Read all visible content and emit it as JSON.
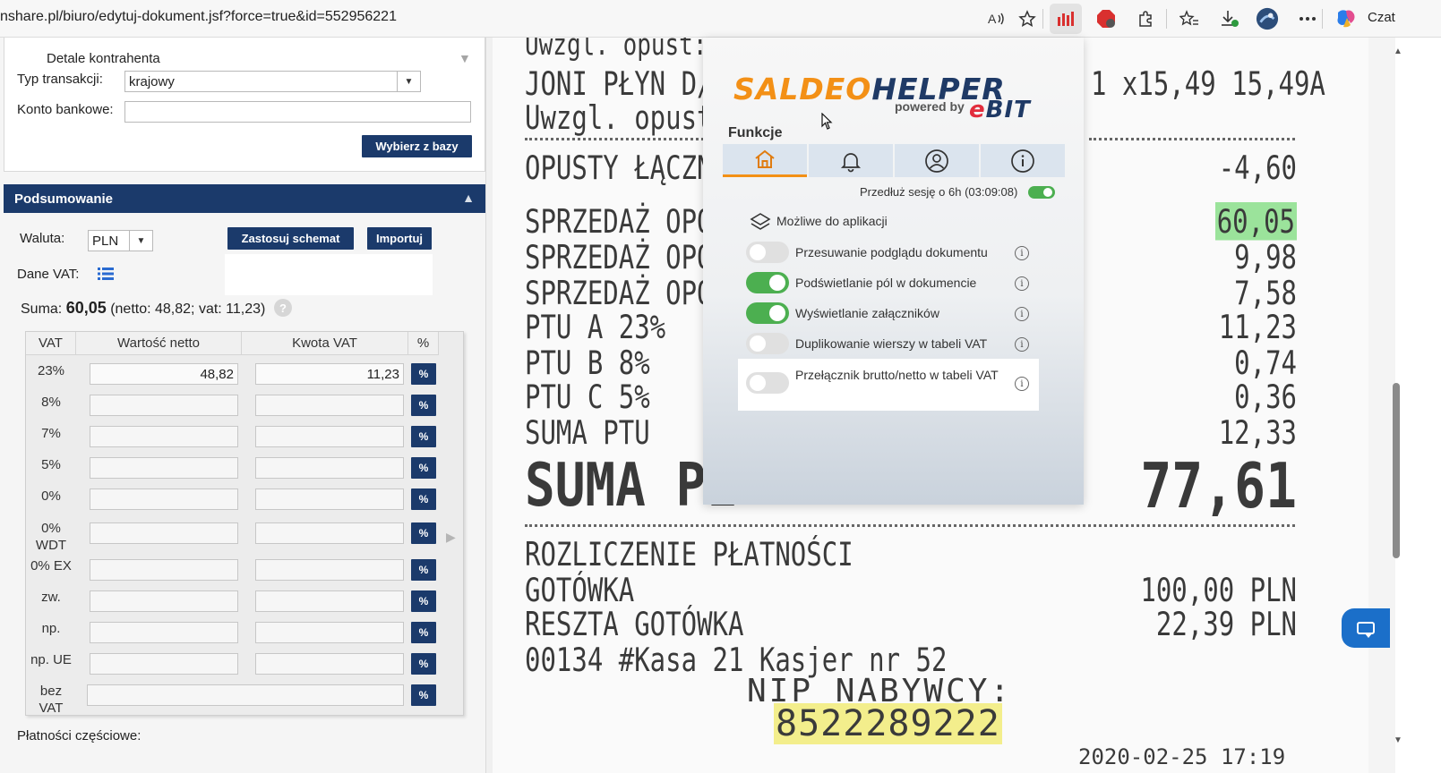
{
  "browser": {
    "url": "nshare.pl/biuro/edytuj-dokument.jsf?force=true&id=552956221",
    "icons": [
      "read-aloud-icon",
      "favorite-star-icon",
      "extension-active-icon",
      "adblock-icon",
      "extensions-puzzle-icon",
      "favorites-icon",
      "downloads-icon",
      "profile-icon",
      "more-icon",
      "copilot-icon"
    ],
    "chat_label": "Czat"
  },
  "contractor": {
    "details_label": "Detale kontrahenta",
    "transaction_type_label": "Typ transakcji:",
    "transaction_type_value": "krajowy",
    "bank_account_label": "Konto bankowe:",
    "bank_account_value": "",
    "select_from_db_button": "Wybierz z bazy"
  },
  "summary": {
    "header": "Podsumowanie",
    "currency_label": "Waluta:",
    "currency_value": "PLN",
    "apply_scheme_button": "Zastosuj schemat",
    "import_button": "Importuj",
    "vat_data_label": "Dane VAT:",
    "suma_label": "Suma:",
    "suma_value": "60,05",
    "suma_details": "(netto: 48,82; vat: 11,23)",
    "help_icon": "?"
  },
  "vat_table": {
    "headers": [
      "VAT",
      "Wartość netto",
      "Kwota VAT",
      "%"
    ],
    "rows": [
      {
        "rate": "23%",
        "netto": "48,82",
        "vat": "11,23"
      },
      {
        "rate": "8%",
        "netto": "",
        "vat": ""
      },
      {
        "rate": "7%",
        "netto": "",
        "vat": ""
      },
      {
        "rate": "5%",
        "netto": "",
        "vat": ""
      },
      {
        "rate": "0%",
        "netto": "",
        "vat": ""
      },
      {
        "rate": "0% WDT",
        "netto": "",
        "vat": ""
      },
      {
        "rate": "0% EX",
        "netto": "",
        "vat": ""
      },
      {
        "rate": "zw.",
        "netto": "",
        "vat": ""
      },
      {
        "rate": "np.",
        "netto": "",
        "vat": ""
      },
      {
        "rate": "np. UE",
        "netto": "",
        "vat": ""
      },
      {
        "rate": "bez VAT",
        "netto": "",
        "vat": ""
      }
    ],
    "pct_label": "%"
  },
  "partial_payments_label": "Płatności częściowe:",
  "receipt": {
    "lines_left": [
      "Uwzgl. opust:",
      "JONI PŁYN D/H",
      "Uwzgl. opust:",
      "OPUSTY ŁĄCZNI",
      "SPRZEDAŻ OPOD",
      "SPRZEDAŻ OPOD",
      "SPRZEDAŻ OPOD",
      "PTU A 23%",
      "PTU B 8%",
      "PTU C 5%",
      "SUMA PTU",
      "SUMA PL"
    ],
    "lines_right": [
      "1 x15,49 15,49A",
      "-4,60",
      "60,05",
      "9,98",
      "7,58",
      "11,23",
      "0,74",
      "0,36",
      "12,33",
      "77,61"
    ],
    "settlement": "ROZLICZENIE PŁATNOŚCI",
    "cash": "GOTÓWKA",
    "cash_value": "100,00 PLN",
    "change": "RESZTA GOTÓWKA",
    "change_value": "22,39 PLN",
    "register": "00134 #Kasa 21 Kasjer nr 52",
    "nip_label": "NIP NABYWCY:",
    "nip_value": "8522289222",
    "cut_line": "2020-02-25 17:19"
  },
  "helper": {
    "logo_part1": "SALDEO",
    "logo_part2": "HELPER",
    "powered_by": "powered by",
    "brand_e": "e",
    "brand_rest": "BIT",
    "functions_label": "Funkcje",
    "tabs": [
      "home-icon",
      "bell-icon",
      "user-icon",
      "info-icon"
    ],
    "extend_session": "Przedłuż sesję o 6h (03:09:08)",
    "applicable_label": "Możliwe do aplikacji",
    "options": [
      {
        "label": "Przesuwanie podglądu dokumentu",
        "on": false
      },
      {
        "label": "Podświetlanie pól w dokumencie",
        "on": true
      },
      {
        "label": "Wyświetlanie załączników",
        "on": true
      },
      {
        "label": "Duplikowanie wierszy w tabeli VAT",
        "on": false
      },
      {
        "label": "Przełącznik brutto/netto w tabeli VAT",
        "on": false
      }
    ],
    "info_glyph": "i"
  },
  "colors": {
    "navy": "#1b3a6b",
    "orange": "#f39016",
    "toggle_on": "#4caf50",
    "highlight_green": "#9be39b",
    "highlight_yellow": "#f3ee8c"
  }
}
